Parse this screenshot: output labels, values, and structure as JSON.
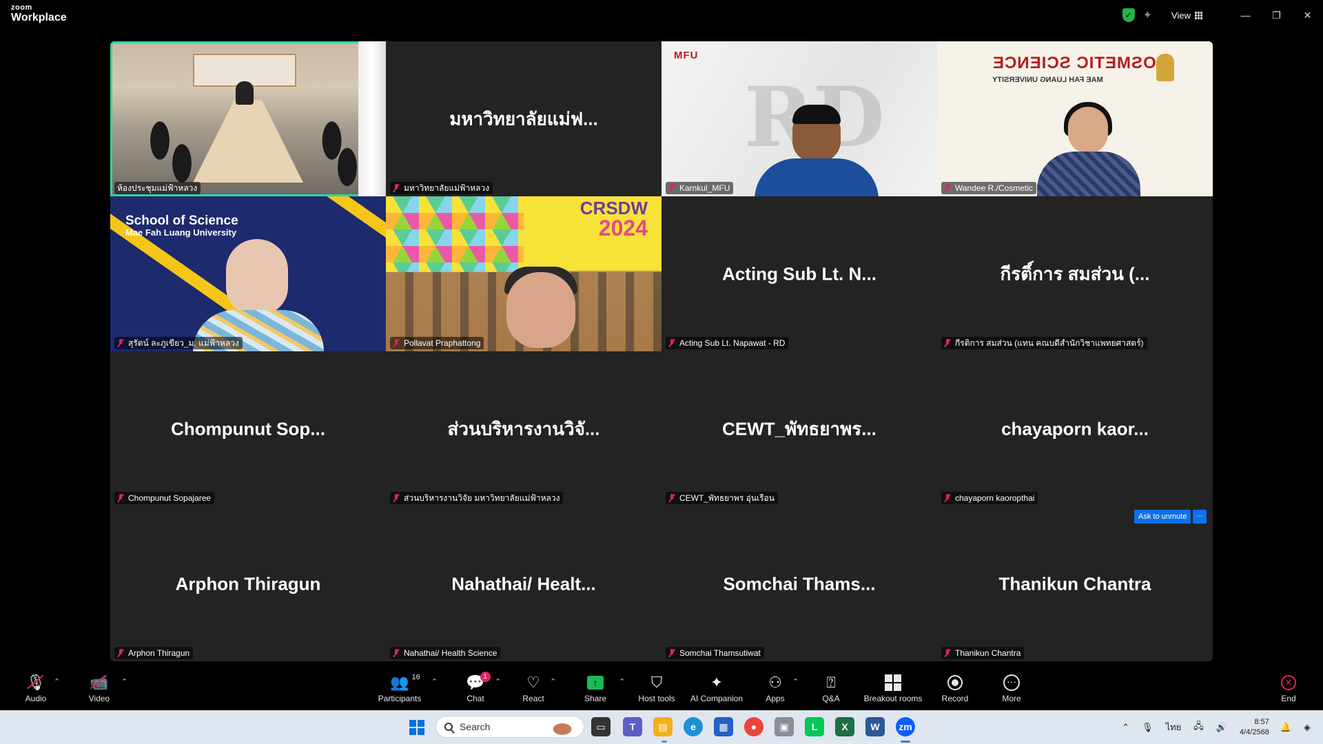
{
  "app": {
    "brand_small": "zoom",
    "brand_big": "Workplace"
  },
  "header": {
    "view_label": "View",
    "shield_icon": "shield-check-icon"
  },
  "tiles": [
    {
      "label": "ห้องประชุมแม่ฟ้าหลวง",
      "big": "",
      "kind": "room",
      "active": true
    },
    {
      "label": "มหาวิทยาลัยแม่ฟ้าหลวง",
      "big": "มหาวิทยาลัยแม่ฟ...",
      "kind": "name"
    },
    {
      "label": "Karnkul_MFU",
      "big": "",
      "kind": "mfu"
    },
    {
      "label": "Wandee R./Cosmetic",
      "big": "",
      "kind": "cos"
    },
    {
      "label": "สุรัตน์ ละภูเขียว_ม. แม่ฟ้าหลวง",
      "big": "",
      "kind": "sci"
    },
    {
      "label": "Pollavat Praphattong",
      "big": "",
      "kind": "crs"
    },
    {
      "label": "Acting Sub Lt. Napawat - RD",
      "big": "Acting Sub Lt. N...",
      "kind": "name"
    },
    {
      "label": "กีรติการ สมส่วน (แทน คณบดีสำนักวิชาแพทยศาสตร์)",
      "big": "กีรติ์การ สมส่วน (...",
      "kind": "name"
    },
    {
      "label": "Chompunut Sopajaree",
      "big": "Chompunut  Sop...",
      "kind": "name"
    },
    {
      "label": "ส่วนบริหารงานวิจัย มหาวิทยาลัยแม่ฟ้าหลวง",
      "big": "ส่วนบริหารงานวิจั...",
      "kind": "name"
    },
    {
      "label": "CEWT_พัทธยาพร อุ่นเรือน",
      "big": "CEWT_พัทธยาพร...",
      "kind": "name"
    },
    {
      "label": "chayaporn kaoropthai",
      "big": "chayaporn  kaor...",
      "kind": "name"
    },
    {
      "label": "Arphon Thiragun",
      "big": "Arphon Thiragun",
      "kind": "name"
    },
    {
      "label": "Nahathai/ Health Science",
      "big": "Nahathai/  Healt...",
      "kind": "name"
    },
    {
      "label": "Somchai Thamsutiwat",
      "big": "Somchai  Thams...",
      "kind": "name"
    },
    {
      "label": "Thanikun Chantra",
      "big": "Thanikun Chantra",
      "kind": "name"
    }
  ],
  "video_text": {
    "mfu_logo": "MFU",
    "mfu_watermark": "RD",
    "cos_title": "COSMETIC SCIENCE",
    "cos_sub": "MAE FAH LUANG UNIVERSITY",
    "sci_title": "School of Science",
    "sci_sub": "Mae Fah Luang University",
    "crs_a": "CRSDW",
    "crs_b": "2024"
  },
  "ask_unmute": {
    "label": "Ask to unmute",
    "more": "···"
  },
  "toolbar": {
    "audio": "Audio",
    "video": "Video",
    "participants": "Participants",
    "participants_count": "16",
    "chat": "Chat",
    "chat_badge": "1",
    "react": "React",
    "share": "Share",
    "host_tools": "Host tools",
    "ai_companion": "AI Companion",
    "apps": "Apps",
    "qa": "Q&A",
    "breakout": "Breakout rooms",
    "record": "Record",
    "more": "More",
    "end": "End"
  },
  "taskbar": {
    "search_placeholder": "Search",
    "lang": "ไทย",
    "time": "8:57",
    "date": "4/4/2568"
  }
}
